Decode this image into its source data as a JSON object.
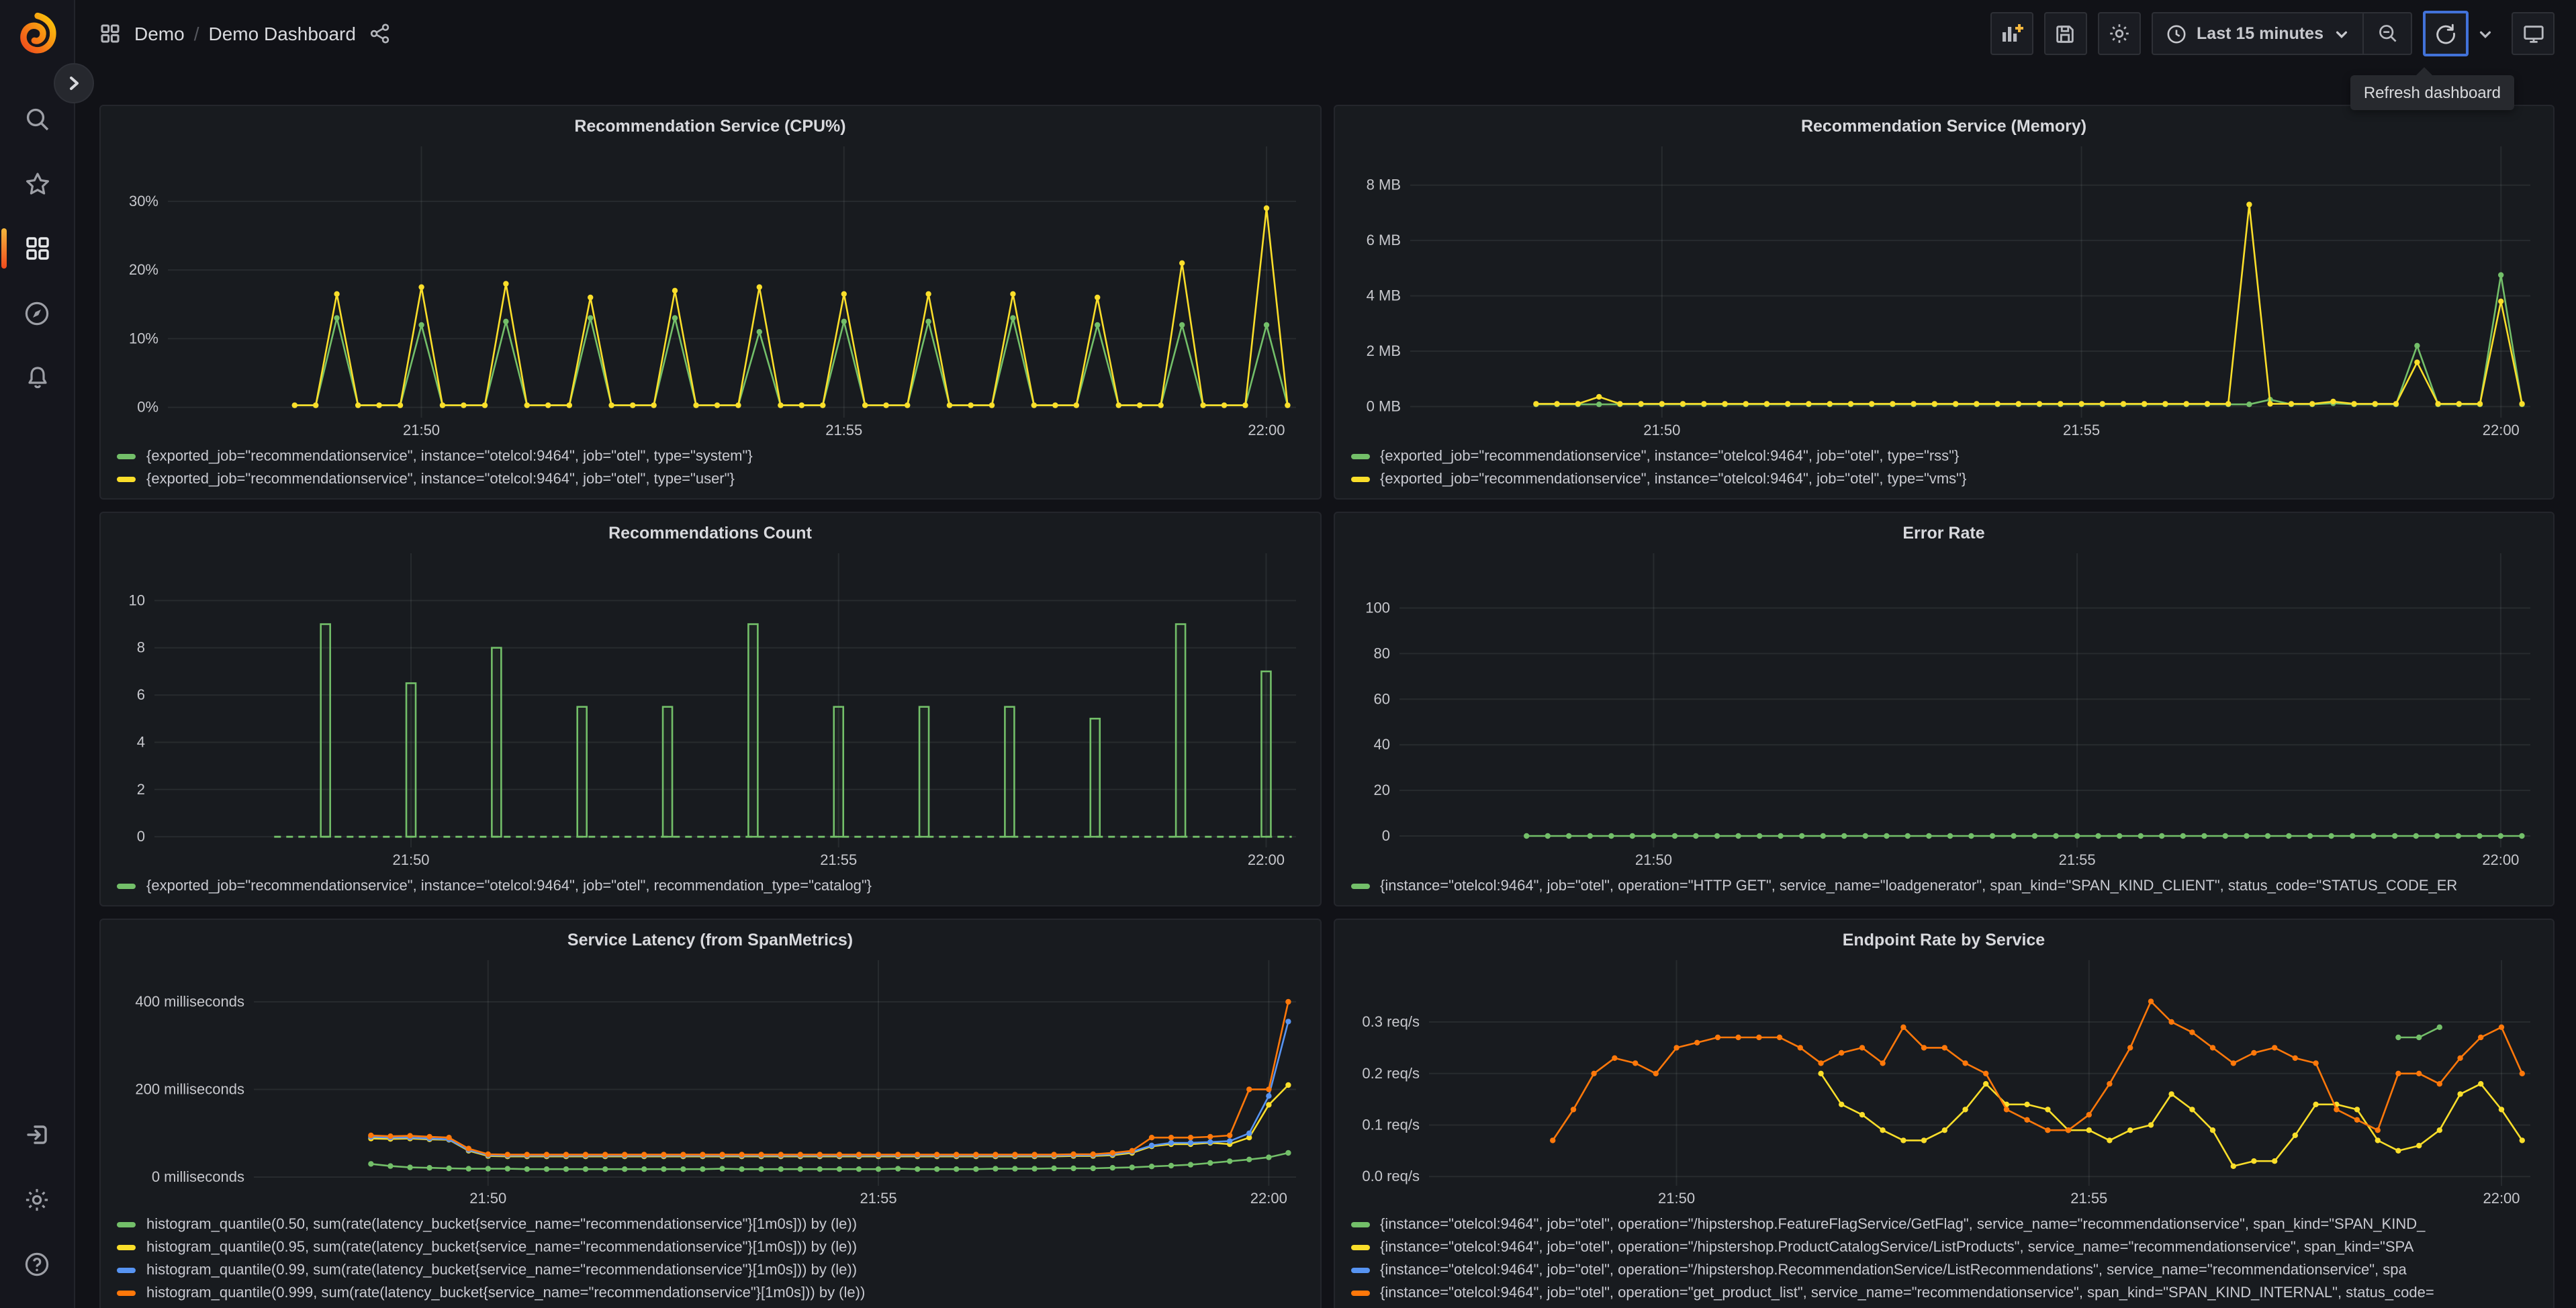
{
  "app": {
    "breadcrumb": {
      "section": "Demo",
      "separator": "/",
      "dashboard": "Demo Dashboard"
    },
    "time_picker": {
      "label": "Last 15 minutes"
    },
    "tooltip": {
      "refresh": "Refresh dashboard"
    },
    "toolbar_icons": [
      "add-panel-icon",
      "save-dashboard-icon",
      "dashboard-settings-icon",
      "clock-icon",
      "zoom-out-icon",
      "refresh-icon",
      "refresh-dropdown-icon",
      "kiosk-mode-icon"
    ],
    "sidebar_icons": [
      "grafana-logo",
      "search-icon",
      "star-icon",
      "dashboards-icon",
      "explore-compass-icon",
      "alerting-bell-icon",
      "sign-in-icon",
      "settings-gear-icon",
      "help-icon"
    ]
  },
  "panels": {
    "cpu": {
      "title": "Recommendation Service (CPU%)",
      "type": "line",
      "y_ticks": [
        {
          "v": 0,
          "label": "0%"
        },
        {
          "v": 10,
          "label": "10%"
        },
        {
          "v": 20,
          "label": "20%"
        },
        {
          "v": 30,
          "label": "30%"
        }
      ],
      "x_ticks": [
        {
          "t": 2,
          "label": "21:50"
        },
        {
          "t": 7,
          "label": "21:55"
        },
        {
          "t": 12,
          "label": "22:00"
        }
      ],
      "series": [
        {
          "name": "system",
          "color": "#73bf69",
          "start": 0.5,
          "step": 0.25,
          "values": [
            0.3,
            0.3,
            13,
            0.3,
            0.3,
            0.3,
            12,
            0.3,
            0.3,
            0.3,
            12.5,
            0.3,
            0.3,
            0.3,
            13,
            0.3,
            0.3,
            0.3,
            13,
            0.3,
            0.3,
            0.3,
            11,
            0.3,
            0.3,
            0.3,
            12.5,
            0.3,
            0.3,
            0.3,
            12.5,
            0.3,
            0.3,
            0.3,
            13,
            0.3,
            0.3,
            0.3,
            12,
            0.3,
            0.3,
            0.3,
            12,
            0.3,
            0.3,
            0.3,
            12,
            0.3
          ]
        },
        {
          "name": "user",
          "color": "#fade2a",
          "start": 0.5,
          "step": 0.25,
          "values": [
            0.3,
            0.3,
            16.5,
            0.3,
            0.3,
            0.3,
            17.5,
            0.3,
            0.3,
            0.3,
            18,
            0.3,
            0.3,
            0.3,
            16,
            0.3,
            0.3,
            0.3,
            17,
            0.3,
            0.3,
            0.3,
            17.5,
            0.3,
            0.3,
            0.3,
            16.5,
            0.3,
            0.3,
            0.3,
            16.5,
            0.3,
            0.3,
            0.3,
            16.5,
            0.3,
            0.3,
            0.3,
            16,
            0.3,
            0.3,
            0.3,
            21,
            0.3,
            0.3,
            0.3,
            29,
            0.3
          ]
        }
      ],
      "legend": [
        {
          "color": "#73bf69",
          "label": "{exported_job=\"recommendationservice\", instance=\"otelcol:9464\", job=\"otel\", type=\"system\"}"
        },
        {
          "color": "#fade2a",
          "label": "{exported_job=\"recommendationservice\", instance=\"otelcol:9464\", job=\"otel\", type=\"user\"}"
        }
      ]
    },
    "memory": {
      "title": "Recommendation Service (Memory)",
      "type": "line",
      "y_ticks": [
        {
          "v": 0,
          "label": "0 MB"
        },
        {
          "v": 2,
          "label": "2 MB"
        },
        {
          "v": 4,
          "label": "4 MB"
        },
        {
          "v": 6,
          "label": "6 MB"
        },
        {
          "v": 8,
          "label": "8 MB"
        }
      ],
      "x_ticks": [
        {
          "t": 2,
          "label": "21:50"
        },
        {
          "t": 7,
          "label": "21:55"
        },
        {
          "t": 12,
          "label": "22:00"
        }
      ],
      "series": [
        {
          "name": "rss",
          "color": "#73bf69",
          "start": 0.5,
          "step": 0.25,
          "values": [
            0.08,
            0.08,
            0.08,
            0.08,
            0.08,
            0.08,
            0.08,
            0.08,
            0.08,
            0.08,
            0.08,
            0.08,
            0.08,
            0.08,
            0.08,
            0.08,
            0.08,
            0.08,
            0.08,
            0.08,
            0.08,
            0.08,
            0.08,
            0.08,
            0.08,
            0.08,
            0.08,
            0.08,
            0.08,
            0.08,
            0.08,
            0.08,
            0.08,
            0.08,
            0.08,
            0.25,
            0.08,
            0.08,
            0.12,
            0.08,
            0.08,
            0.08,
            2.2,
            0.08,
            0.08,
            0.08,
            4.75,
            0.08
          ]
        },
        {
          "name": "vms",
          "color": "#fade2a",
          "start": 0.5,
          "step": 0.25,
          "values": [
            0.1,
            0.1,
            0.1,
            0.35,
            0.1,
            0.1,
            0.1,
            0.1,
            0.1,
            0.1,
            0.1,
            0.1,
            0.1,
            0.1,
            0.1,
            0.1,
            0.1,
            0.1,
            0.1,
            0.1,
            0.1,
            0.1,
            0.1,
            0.1,
            0.1,
            0.1,
            0.1,
            0.1,
            0.1,
            0.1,
            0.1,
            0.1,
            0.1,
            0.1,
            7.3,
            0.1,
            0.1,
            0.1,
            0.18,
            0.1,
            0.1,
            0.1,
            1.6,
            0.1,
            0.1,
            0.1,
            3.8,
            0.1
          ]
        }
      ],
      "legend": [
        {
          "color": "#73bf69",
          "label": "{exported_job=\"recommendationservice\", instance=\"otelcol:9464\", job=\"otel\", type=\"rss\"}"
        },
        {
          "color": "#fade2a",
          "label": "{exported_job=\"recommendationservice\", instance=\"otelcol:9464\", job=\"otel\", type=\"vms\"}"
        }
      ]
    },
    "count": {
      "title": "Recommendations Count",
      "type": "bars",
      "y_ticks": [
        {
          "v": 0,
          "label": "0"
        },
        {
          "v": 2,
          "label": "2"
        },
        {
          "v": 4,
          "label": "4"
        },
        {
          "v": 6,
          "label": "6"
        },
        {
          "v": 8,
          "label": "8"
        },
        {
          "v": 10,
          "label": "10"
        }
      ],
      "x_ticks": [
        {
          "t": 2,
          "label": "21:50"
        },
        {
          "t": 7,
          "label": "21:55"
        },
        {
          "t": 12,
          "label": "22:00"
        }
      ],
      "series": [
        {
          "name": "catalog",
          "color": "#73bf69",
          "start": 1,
          "step": 1,
          "values": [
            9,
            6.5,
            8,
            5.5,
            5.5,
            9,
            5.5,
            5.5,
            5.5,
            5,
            9,
            7
          ]
        }
      ],
      "baseline": {
        "from": 0.4,
        "to": 12.3
      },
      "legend": [
        {
          "color": "#73bf69",
          "label": "{exported_job=\"recommendationservice\", instance=\"otelcol:9464\", job=\"otel\", recommendation_type=\"catalog\"}"
        }
      ]
    },
    "error": {
      "title": "Error Rate",
      "type": "line",
      "y_ticks": [
        {
          "v": 0,
          "label": "0"
        },
        {
          "v": 20,
          "label": "20"
        },
        {
          "v": 40,
          "label": "40"
        },
        {
          "v": 60,
          "label": "60"
        },
        {
          "v": 80,
          "label": "80"
        },
        {
          "v": 100,
          "label": "100"
        }
      ],
      "x_ticks": [
        {
          "t": 2,
          "label": "21:50"
        },
        {
          "t": 7,
          "label": "21:55"
        },
        {
          "t": 12,
          "label": "22:00"
        }
      ],
      "series": [
        {
          "name": "http-get-errors",
          "color": "#73bf69",
          "start": 0.5,
          "step": 0.25,
          "values": [
            0,
            0,
            0,
            0,
            0,
            0,
            0,
            0,
            0,
            0,
            0,
            0,
            0,
            0,
            0,
            0,
            0,
            0,
            0,
            0,
            0,
            0,
            0,
            0,
            0,
            0,
            0,
            0,
            0,
            0,
            0,
            0,
            0,
            0,
            0,
            0,
            0,
            0,
            0,
            0,
            0,
            0,
            0,
            0,
            0,
            0,
            0,
            0
          ]
        }
      ],
      "legend": [
        {
          "color": "#73bf69",
          "label": "{instance=\"otelcol:9464\", job=\"otel\", operation=\"HTTP GET\", service_name=\"loadgenerator\", span_kind=\"SPAN_KIND_CLIENT\", status_code=\"STATUS_CODE_ER"
        }
      ]
    },
    "latency": {
      "title": "Service Latency (from SpanMetrics)",
      "type": "line",
      "y_ticks": [
        {
          "v": 0,
          "label": "0 milliseconds"
        },
        {
          "v": 200,
          "label": "200 milliseconds"
        },
        {
          "v": 400,
          "label": "400 milliseconds"
        }
      ],
      "x_ticks": [
        {
          "t": 2,
          "label": "21:50"
        },
        {
          "t": 7,
          "label": "21:55"
        },
        {
          "t": 12,
          "label": "22:00"
        }
      ],
      "series": [
        {
          "name": "p50",
          "color": "#73bf69",
          "start": 0.5,
          "step": 0.25,
          "values": [
            30,
            25,
            22,
            21,
            20,
            19,
            19,
            19,
            18,
            18,
            18,
            18,
            18,
            18,
            18,
            18,
            18,
            18,
            19,
            18,
            18,
            18,
            18,
            18,
            18,
            18,
            18,
            19,
            18,
            18,
            18,
            18,
            19,
            19,
            19,
            20,
            20,
            20,
            21,
            22,
            24,
            26,
            28,
            32,
            36,
            40,
            45,
            55
          ]
        },
        {
          "name": "p95",
          "color": "#fade2a",
          "start": 0.5,
          "step": 0.25,
          "values": [
            88,
            87,
            88,
            86,
            85,
            60,
            48,
            47,
            47,
            47,
            47,
            47,
            47,
            47,
            47,
            47,
            47,
            47,
            47,
            47,
            47,
            47,
            47,
            47,
            47,
            47,
            47,
            47,
            47,
            47,
            47,
            47,
            47,
            47,
            47,
            47,
            48,
            48,
            50,
            55,
            70,
            75,
            75,
            78,
            75,
            90,
            165,
            210
          ]
        },
        {
          "name": "p99",
          "color": "#5794f2",
          "start": 0.5,
          "step": 0.25,
          "values": [
            92,
            90,
            90,
            88,
            86,
            62,
            50,
            49,
            49,
            49,
            49,
            49,
            49,
            49,
            49,
            49,
            49,
            49,
            49,
            49,
            49,
            49,
            49,
            49,
            49,
            49,
            49,
            49,
            49,
            49,
            49,
            49,
            49,
            49,
            49,
            49,
            50,
            50,
            52,
            58,
            72,
            78,
            78,
            80,
            82,
            100,
            185,
            355
          ]
        },
        {
          "name": "p999",
          "color": "#ff780a",
          "start": 0.5,
          "step": 0.25,
          "values": [
            95,
            93,
            94,
            92,
            90,
            65,
            52,
            51,
            51,
            51,
            51,
            51,
            51,
            51,
            51,
            51,
            51,
            51,
            51,
            51,
            51,
            51,
            51,
            51,
            51,
            51,
            51,
            51,
            51,
            51,
            51,
            51,
            51,
            51,
            51,
            51,
            52,
            52,
            55,
            60,
            90,
            90,
            90,
            92,
            95,
            200,
            200,
            400
          ]
        }
      ],
      "legend": [
        {
          "color": "#73bf69",
          "label": "histogram_quantile(0.50, sum(rate(latency_bucket{service_name=\"recommendationservice\"}[1m0s])) by (le))"
        },
        {
          "color": "#fade2a",
          "label": "histogram_quantile(0.95, sum(rate(latency_bucket{service_name=\"recommendationservice\"}[1m0s])) by (le))"
        },
        {
          "color": "#5794f2",
          "label": "histogram_quantile(0.99, sum(rate(latency_bucket{service_name=\"recommendationservice\"}[1m0s])) by (le))"
        },
        {
          "color": "#ff780a",
          "label": "histogram_quantile(0.999, sum(rate(latency_bucket{service_name=\"recommendationservice\"}[1m0s])) by (le))"
        }
      ]
    },
    "endpoint": {
      "title": "Endpoint Rate by Service",
      "type": "line",
      "y_ticks": [
        {
          "v": 0,
          "label": "0.0 req/s"
        },
        {
          "v": 0.1,
          "label": "0.1 req/s"
        },
        {
          "v": 0.2,
          "label": "0.2 req/s"
        },
        {
          "v": 0.3,
          "label": "0.3 req/s"
        }
      ],
      "x_ticks": [
        {
          "t": 2,
          "label": "21:50"
        },
        {
          "t": 7,
          "label": "21:55"
        },
        {
          "t": 12,
          "label": "22:00"
        }
      ],
      "series": [
        {
          "name": "ListProducts",
          "color": "#fade2a",
          "start": 3.75,
          "step": 0.25,
          "values": [
            0.2,
            0.14,
            0.12,
            0.09,
            0.07,
            0.07,
            0.09,
            0.13,
            0.18,
            0.14,
            0.14,
            0.13,
            0.09,
            0.09,
            0.07,
            0.09,
            0.1,
            0.16,
            0.13,
            0.09,
            0.02,
            0.03,
            0.03,
            0.08,
            0.14,
            0.14,
            0.13,
            0.07,
            0.05,
            0.06,
            0.09,
            0.16,
            0.18,
            0.13,
            0.07
          ]
        },
        {
          "name": "GetFlag",
          "color": "#73bf69",
          "start": 10.75,
          "step": 0.25,
          "values": [
            0.27,
            0.27,
            0.29
          ]
        },
        {
          "name": "get_product_list",
          "color": "#ff780a",
          "start": 0.5,
          "step": 0.25,
          "values": [
            0.07,
            0.13,
            0.2,
            0.23,
            0.22,
            0.2,
            0.25,
            0.26,
            0.27,
            0.27,
            0.27,
            0.27,
            0.25,
            0.22,
            0.24,
            0.25,
            0.22,
            0.29,
            0.25,
            0.25,
            0.22,
            0.2,
            0.13,
            0.11,
            0.09,
            0.09,
            0.12,
            0.18,
            0.25,
            0.34,
            0.3,
            0.28,
            0.25,
            0.22,
            0.24,
            0.25,
            0.23,
            0.22,
            0.13,
            0.11,
            0.09,
            0.2,
            0.2,
            0.18,
            0.23,
            0.27,
            0.29,
            0.2
          ]
        }
      ],
      "legend": [
        {
          "color": "#73bf69",
          "label": "{instance=\"otelcol:9464\", job=\"otel\", operation=\"/hipstershop.FeatureFlagService/GetFlag\", service_name=\"recommendationservice\", span_kind=\"SPAN_KIND_"
        },
        {
          "color": "#fade2a",
          "label": "{instance=\"otelcol:9464\", job=\"otel\", operation=\"/hipstershop.ProductCatalogService/ListProducts\", service_name=\"recommendationservice\", span_kind=\"SPA"
        },
        {
          "color": "#5794f2",
          "label": "{instance=\"otelcol:9464\", job=\"otel\", operation=\"/hipstershop.RecommendationService/ListRecommendations\", service_name=\"recommendationservice\", spa"
        },
        {
          "color": "#ff780a",
          "label": "{instance=\"otelcol:9464\", job=\"otel\", operation=\"get_product_list\", service_name=\"recommendationservice\", span_kind=\"SPAN_KIND_INTERNAL\", status_code="
        }
      ]
    }
  }
}
